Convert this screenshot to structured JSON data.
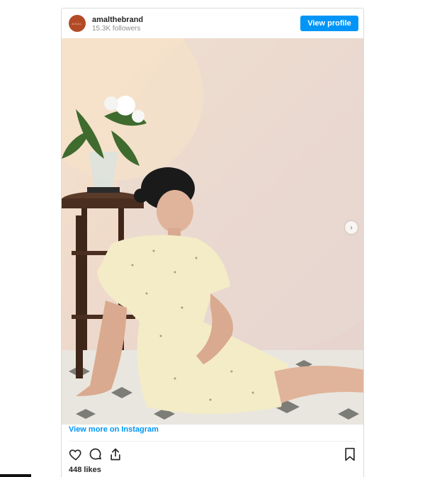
{
  "post": {
    "username": "amalthebrand",
    "followers": "15.3K followers",
    "view_profile_label": "View profile",
    "view_more_label": "View more on Instagram",
    "likes": "448 likes"
  },
  "icons": {
    "like": "heart-icon",
    "comment": "comment-icon",
    "share": "share-icon",
    "save": "bookmark-icon",
    "next": "chevron-right-icon"
  },
  "colors": {
    "accent": "#0095f6",
    "avatar": "#b34a26",
    "text": "#262626",
    "muted": "#8e8e8e"
  }
}
